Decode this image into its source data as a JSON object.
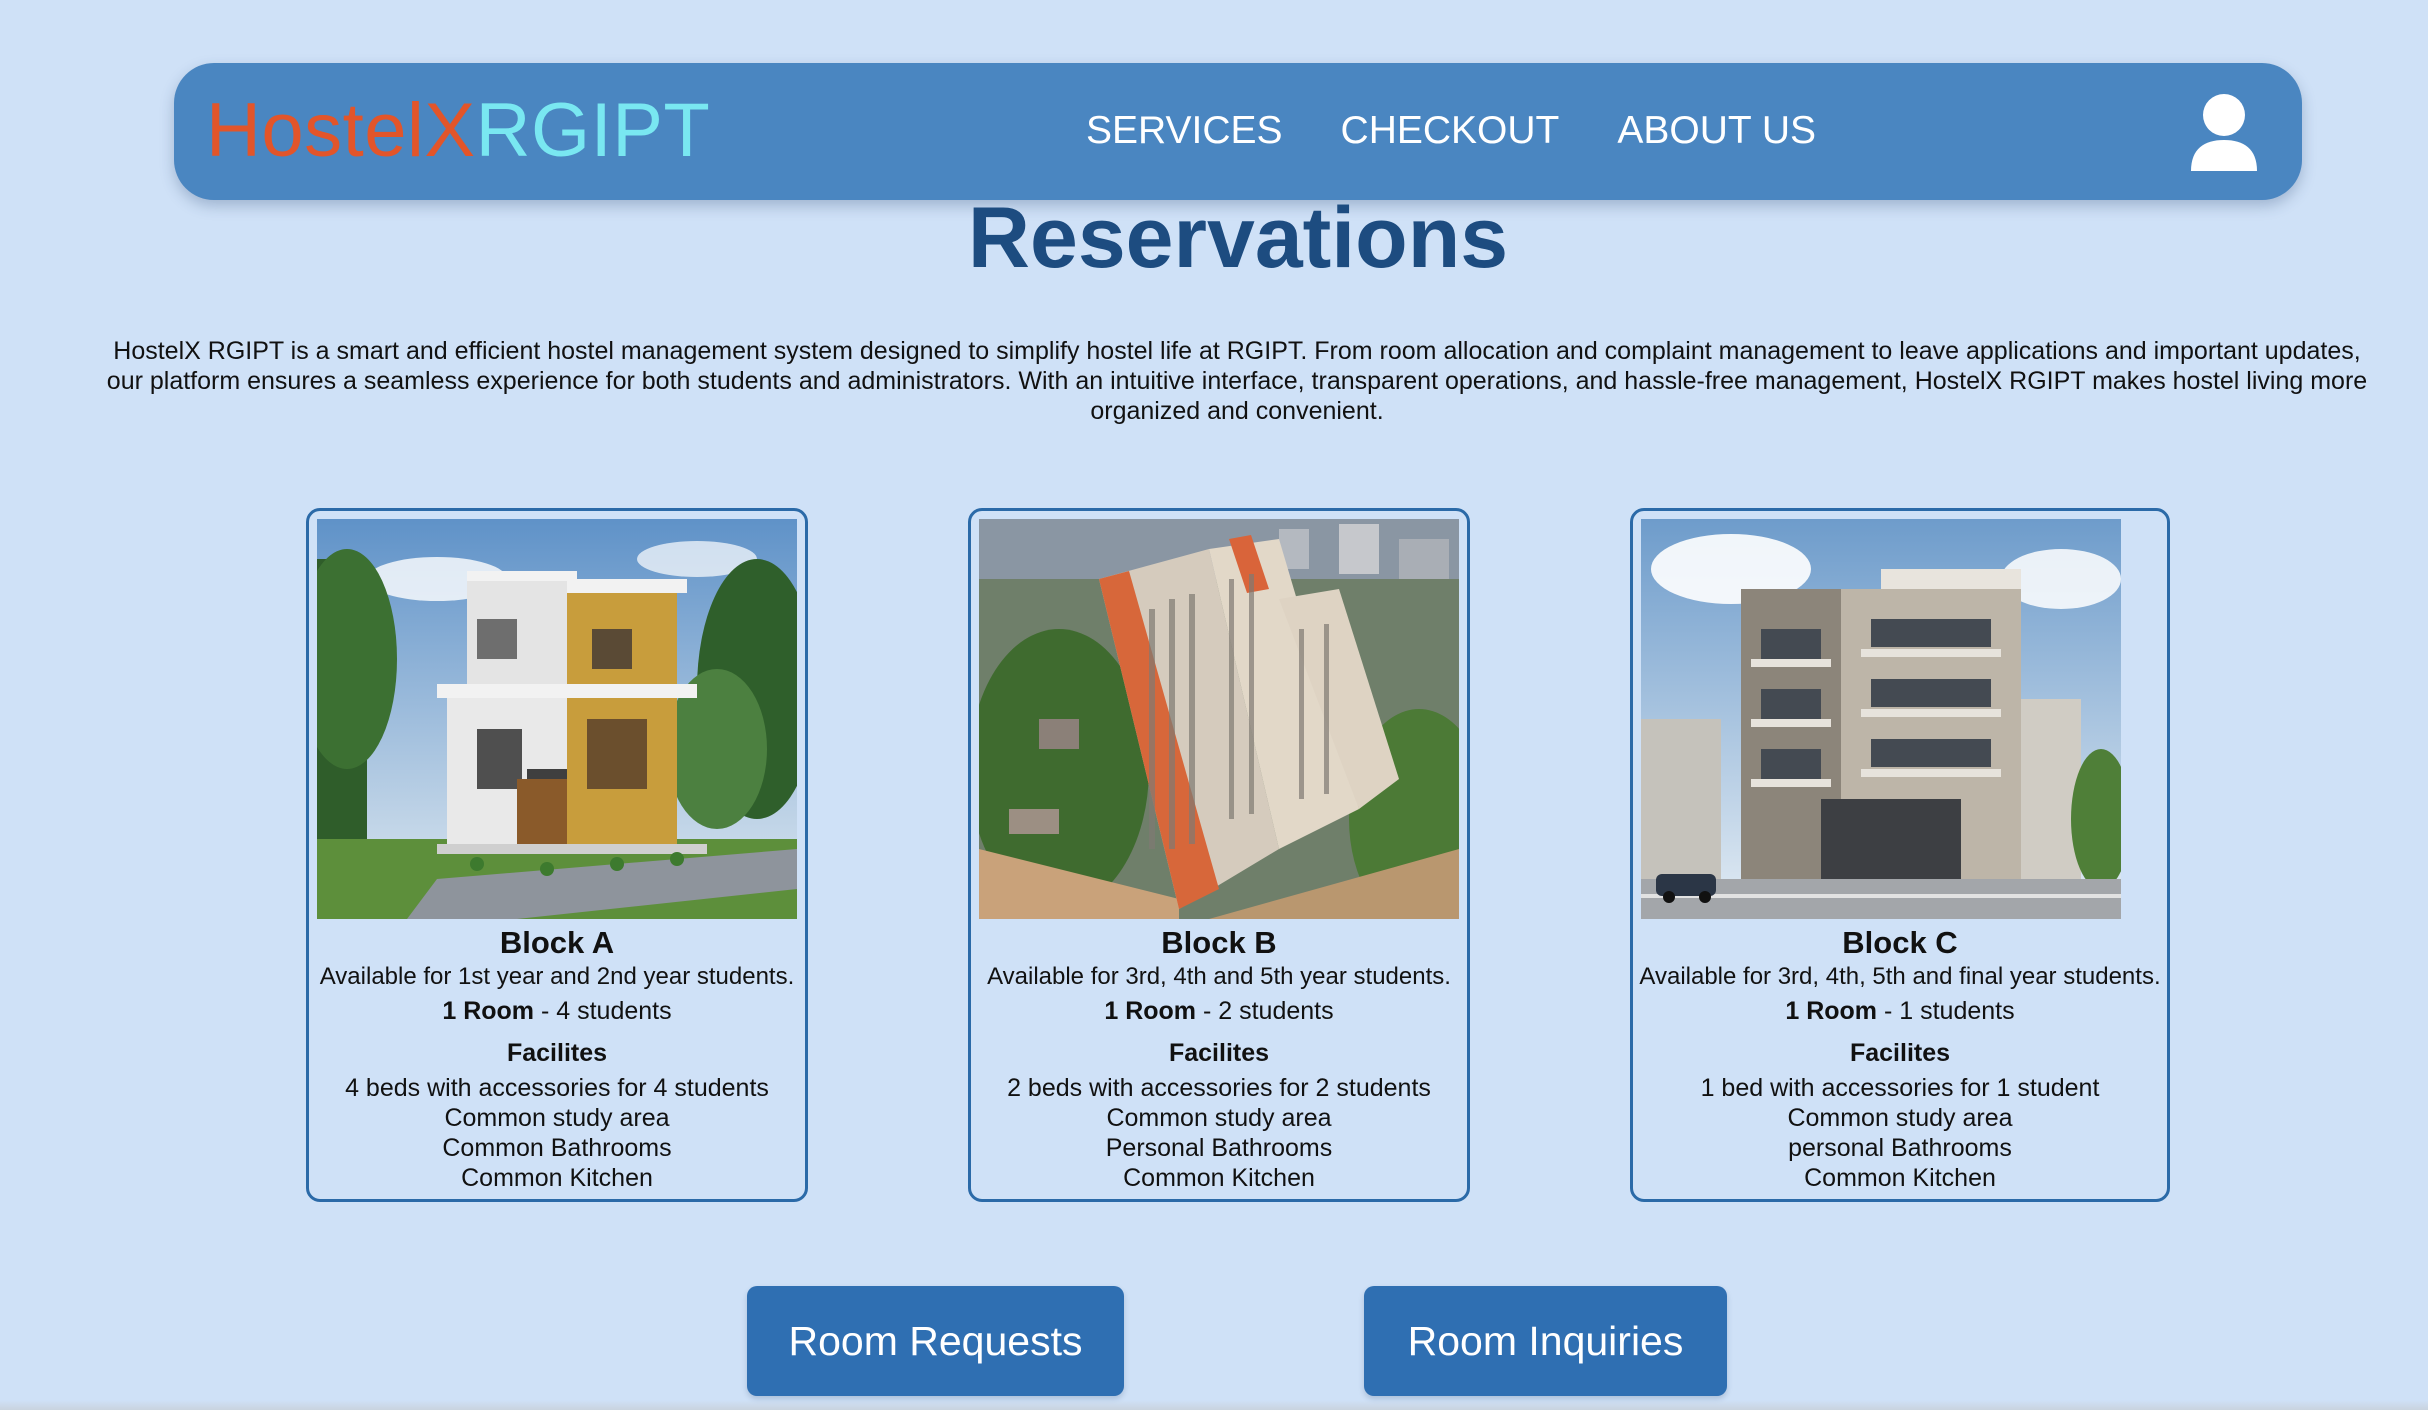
{
  "brand": {
    "part_a": "HostelX",
    "part_b": "RGIPT"
  },
  "nav": {
    "links": [
      "SERVICES",
      "CHECKOUT",
      "ABOUT US"
    ]
  },
  "icons": {
    "user": "user-profile-icon"
  },
  "colors": {
    "background": "#cfe1f7",
    "navbar": "#4a86c1",
    "brand_part_a": "#e2552a",
    "brand_part_b": "#79e7f1",
    "title": "#1d4c80",
    "card_border": "#2b6aa8",
    "button": "#2f6fb2"
  },
  "page": {
    "title": "Reservations",
    "intro": "HostelX RGIPT is a smart and efficient hostel management system designed to simplify hostel life at RGIPT. From room allocation and complaint management to leave applications and important updates, our platform ensures a seamless experience for both students and administrators. With an intuitive interface, transparent operations, and hassle-free management, HostelX RGIPT makes hostel living more organized and convenient."
  },
  "cards": [
    {
      "title": "Block A",
      "subtitle": "Available for 1st year and 2nd year students.",
      "room_label": "1 Room",
      "room_value": " - 4 students",
      "facilities_title": "Facilites",
      "facilities": [
        "4 beds with accessories for 4 students",
        "Common study area",
        "Common Bathrooms",
        "Common Kitchen"
      ]
    },
    {
      "title": "Block B",
      "subtitle": "Available for 3rd, 4th and 5th year students.",
      "room_label": "1 Room",
      "room_value": " - 2 students",
      "facilities_title": "Facilites",
      "facilities": [
        "2 beds with accessories for 2 students",
        "Common study area",
        "Personal Bathrooms",
        "Common Kitchen"
      ]
    },
    {
      "title": "Block C",
      "subtitle": "Available for 3rd, 4th, 5th and final year students.",
      "room_label": "1 Room",
      "room_value": " - 1 students",
      "facilities_title": "Facilites",
      "facilities": [
        "1 bed with accessories for 1 student",
        "Common study area",
        "personal Bathrooms",
        "Common Kitchen"
      ]
    }
  ],
  "buttons": {
    "requests": "Room Requests",
    "inquiries": "Room Inquiries"
  }
}
